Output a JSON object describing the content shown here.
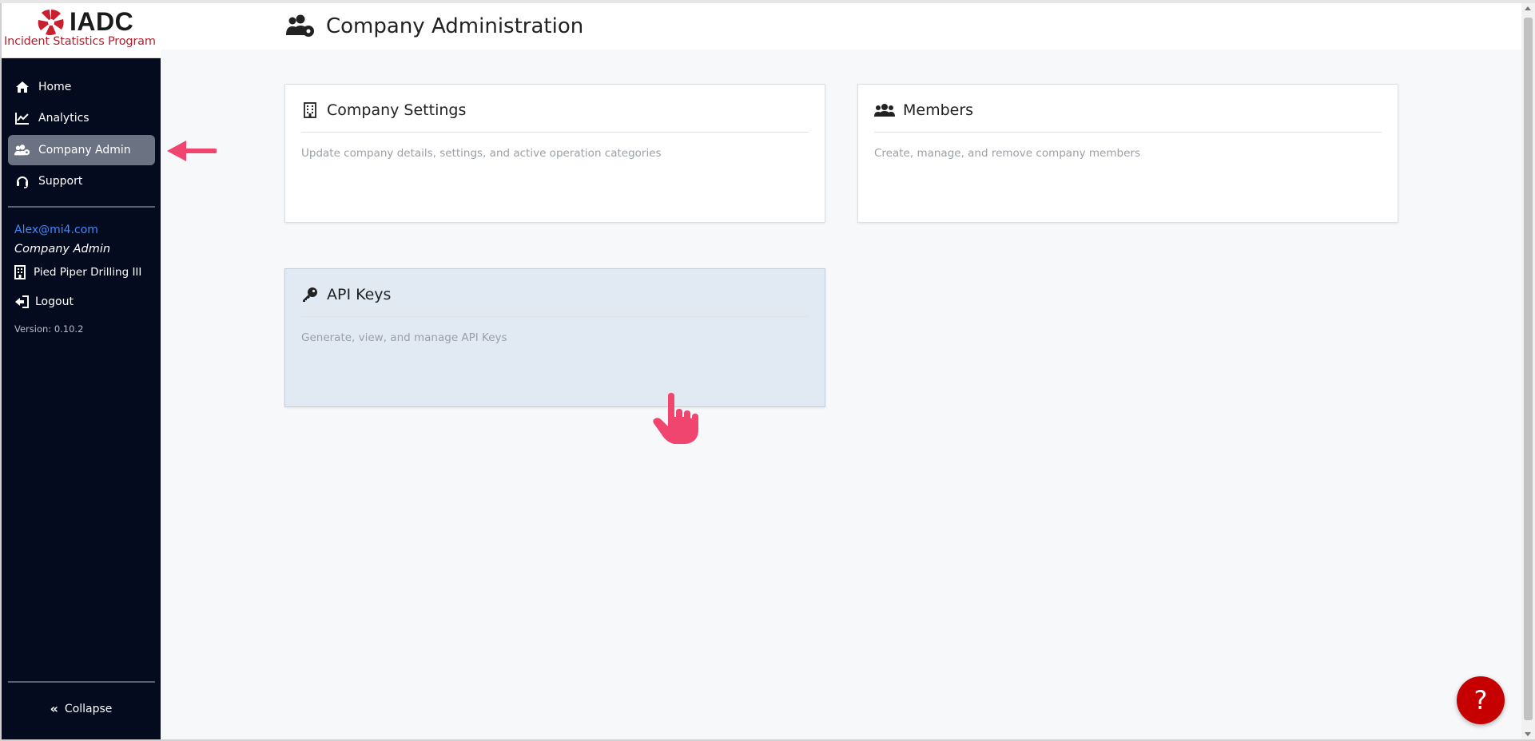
{
  "brand": {
    "logo_text": "IADC",
    "subtitle": "Incident Statistics Program"
  },
  "sidebar": {
    "items": [
      {
        "label": "Home",
        "icon": "home-icon"
      },
      {
        "label": "Analytics",
        "icon": "chart-line-icon"
      },
      {
        "label": "Company Admin",
        "icon": "users-cog-icon",
        "active": true
      },
      {
        "label": "Support",
        "icon": "headset-icon"
      }
    ],
    "user_email": "Alex@mi4.com",
    "user_role": "Company Admin",
    "company_name": "Pied Piper Drilling III",
    "logout_label": "Logout",
    "version": "Version: 0.10.2",
    "collapse_label": "Collapse"
  },
  "header": {
    "title": "Company Administration"
  },
  "cards": [
    {
      "title": "Company Settings",
      "description": "Update company details, settings, and active operation categories",
      "icon": "building-icon"
    },
    {
      "title": "Members",
      "description": "Create, manage, and remove company members",
      "icon": "users-icon"
    },
    {
      "title": "API Keys",
      "description": "Generate, view, and manage API Keys",
      "icon": "key-icon",
      "hovered": true
    }
  ],
  "help_button": "?",
  "colors": {
    "sidebar_bg": "#050b1f",
    "active_item_bg": "#6b7281",
    "brand_red": "#b21f2d",
    "link_blue": "#3d8bff",
    "help_red": "#c60000",
    "annotation_pink": "#f0456e"
  }
}
